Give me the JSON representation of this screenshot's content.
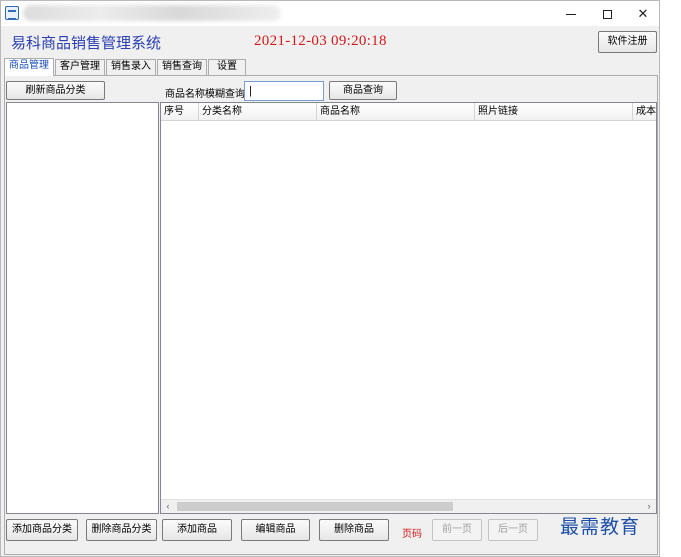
{
  "window": {
    "controls": {
      "minimize": "minimize",
      "maximize": "maximize",
      "close": "✕"
    }
  },
  "header": {
    "app_title": "易科商品销售管理系统",
    "datetime": "2021-12-03  09:20:18",
    "register_label": "软件注册"
  },
  "tabs": [
    {
      "label": "商品管理",
      "active": true
    },
    {
      "label": "客户管理",
      "active": false
    },
    {
      "label": "销售录入",
      "active": false
    },
    {
      "label": "销售查询",
      "active": false
    },
    {
      "label": "设置",
      "active": false
    }
  ],
  "left_pane": {
    "refresh_label": "刷新商品分类"
  },
  "search": {
    "label": "商品名称模糊查询",
    "value": "|",
    "button_label": "商品查询"
  },
  "grid": {
    "columns": [
      "序号",
      "分类名称",
      "商品名称",
      "照片链接",
      "成本"
    ]
  },
  "bottom": {
    "add_category": "添加商品分类",
    "delete_category": "删除商品分类",
    "add_product": "添加商品",
    "edit_product": "编辑商品",
    "delete_product": "删除商品",
    "page_label": "页码",
    "prev_page": "前一页",
    "next_page": "后一页"
  },
  "watermark": "最需教育",
  "colors": {
    "title_blue": "#2a3fb5",
    "clock_red": "#d01818",
    "watermark_blue": "#1d4fa8"
  }
}
